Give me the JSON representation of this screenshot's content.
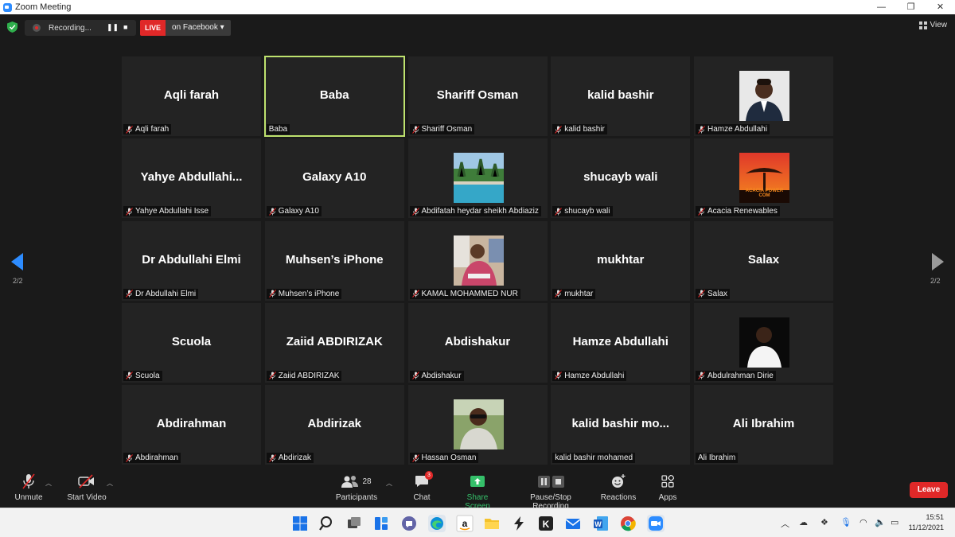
{
  "window": {
    "title": "Zoom Meeting",
    "controls": [
      "—",
      "❐",
      "✕"
    ]
  },
  "topbar": {
    "recording_label": "Recording...",
    "live_badge": "LIVE",
    "live_destination": "on Facebook",
    "view_label": "View"
  },
  "pagination": {
    "left": "2/2",
    "right": "2/2"
  },
  "participants": [
    {
      "display": "Aqli farah",
      "label": "Aqli farah",
      "muted": true
    },
    {
      "display": "Baba",
      "label": "Baba",
      "muted": false,
      "active": true
    },
    {
      "display": "Shariff Osman",
      "label": "Shariff Osman",
      "muted": true
    },
    {
      "display": "kalid bashir",
      "label": "kalid bashir",
      "muted": true
    },
    {
      "display": "",
      "label": "Hamze Abdullahi",
      "muted": true,
      "photo": "portrait-suit"
    },
    {
      "display": "Yahye  Abdullahi...",
      "label": "Yahye Abdullahi Isse",
      "muted": true
    },
    {
      "display": "Galaxy A10",
      "label": "Galaxy A10",
      "muted": true
    },
    {
      "display": "",
      "label": "Abdifatah heydar sheikh Abdiaziz",
      "muted": true,
      "photo": "pool"
    },
    {
      "display": "shucayb wali",
      "label": "shucayb wali",
      "muted": true
    },
    {
      "display": "",
      "label": "Acacia Renewables",
      "muted": true,
      "photo": "acacia-logo",
      "photo_text": "ACACIA POWER COM"
    },
    {
      "display": "Dr Abdullahi Elmi",
      "label": "Dr Abdullahi Elmi",
      "muted": true
    },
    {
      "display": "Muhsen’s iPhone",
      "label": "Muhsen’s iPhone",
      "muted": true
    },
    {
      "display": "",
      "label": "KAMAL MOHAMMED NUR",
      "muted": true,
      "photo": "portrait-event"
    },
    {
      "display": "mukhtar",
      "label": "mukhtar",
      "muted": true
    },
    {
      "display": "Salax",
      "label": "Salax",
      "muted": true
    },
    {
      "display": "Scuola",
      "label": "Scuola",
      "muted": true
    },
    {
      "display": "Zaiid ABDIRIZAK",
      "label": "Zaiid ABDIRIZAK",
      "muted": true
    },
    {
      "display": "Abdishakur",
      "label": "Abdishakur",
      "muted": true
    },
    {
      "display": "Hamze Abdullahi",
      "label": "Hamze Abdullahi",
      "muted": true
    },
    {
      "display": "",
      "label": "Abdulrahman Dirie",
      "muted": true,
      "photo": "portrait-white-shirt"
    },
    {
      "display": "Abdirahman",
      "label": "Abdirahman",
      "muted": true
    },
    {
      "display": "Abdirizak",
      "label": "Abdirizak",
      "muted": true
    },
    {
      "display": "",
      "label": "Hassan Osman",
      "muted": true,
      "photo": "portrait-sunglasses"
    },
    {
      "display": "kalid  bashir  mo...",
      "label": "kalid bashir mohamed",
      "muted": false
    },
    {
      "display": "Ali Ibrahim",
      "label": "Ali Ibrahim",
      "muted": false
    }
  ],
  "toolbar": {
    "unmute": "Unmute",
    "start_video": "Start Video",
    "participants": "Participants",
    "participants_count": "28",
    "chat": "Chat",
    "chat_badge": "3",
    "share_screen": "Share Screen",
    "pause_stop_recording": "Pause/Stop Recording",
    "reactions": "Reactions",
    "apps": "Apps",
    "leave": "Leave"
  },
  "taskbar": {
    "time": "15:51",
    "date": "11/12/2021"
  },
  "colors": {
    "active_speaker": "#bee26e",
    "live_red": "#e02828",
    "share_green": "#35c06a",
    "tile_bg": "#232323"
  }
}
